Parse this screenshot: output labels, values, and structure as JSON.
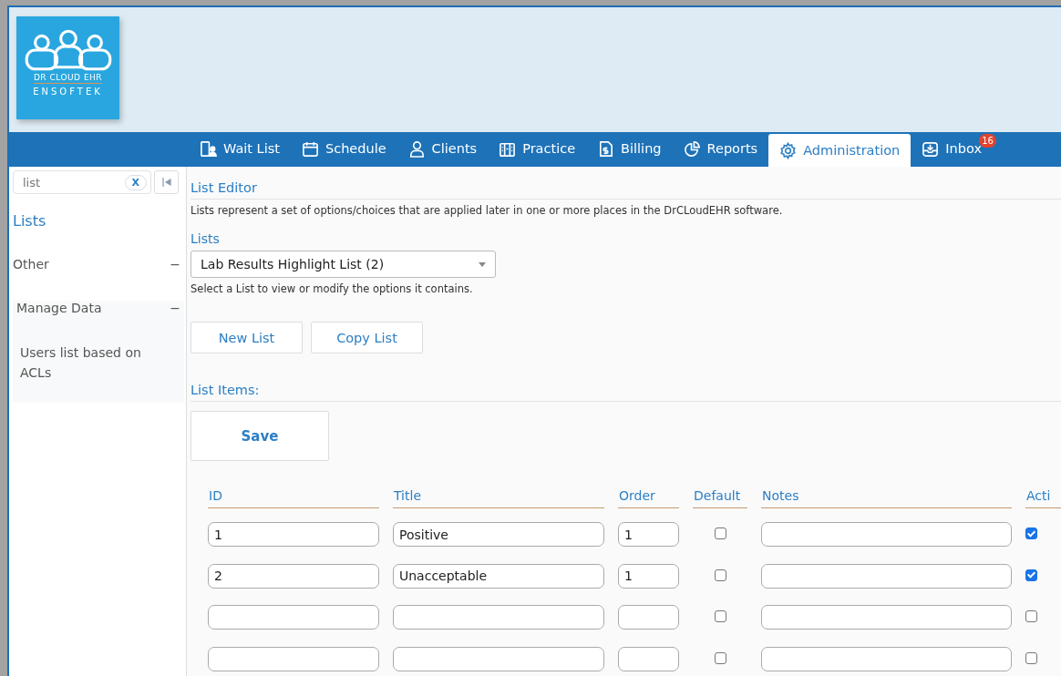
{
  "logo": {
    "name": "DR CLOUD EHR",
    "company": "ENSOFTEK"
  },
  "tabs": [
    {
      "label": "Wait List",
      "selected": false
    },
    {
      "label": "Schedule",
      "selected": false
    },
    {
      "label": "Clients",
      "selected": false
    },
    {
      "label": "Practice",
      "selected": false
    },
    {
      "label": "Billing",
      "selected": false
    },
    {
      "label": "Reports",
      "selected": false
    },
    {
      "label": "Administration",
      "selected": true
    },
    {
      "label": "Inbox",
      "selected": false,
      "badge": "16"
    }
  ],
  "sidebar": {
    "search": {
      "value": "list",
      "clear": "X"
    },
    "title": "Lists",
    "groups": [
      {
        "label": "Other",
        "toggle": "−"
      },
      {
        "label": "Manage Data",
        "toggle": "−",
        "children": [
          {
            "label": "Users list based on ACLs"
          }
        ]
      }
    ]
  },
  "editor": {
    "title": "List Editor",
    "description": "Lists represent a set of options/choices that are applied later in one or more places in the DrCLoudEHR software.",
    "lists_label": "Lists",
    "selected_list": "Lab Results Highlight List (2)",
    "select_hint": "Select a List to view or modify the options it contains.",
    "buttons": [
      "New List",
      "Copy List"
    ],
    "items_title": "List Items:",
    "save": "Save"
  },
  "table": {
    "columns": [
      "ID",
      "Title",
      "Order",
      "Default",
      "Notes",
      "Acti"
    ],
    "rows": [
      {
        "id": "1",
        "title": "Positive",
        "order": "1",
        "default": false,
        "notes": "",
        "active": true
      },
      {
        "id": "2",
        "title": "Unacceptable",
        "order": "1",
        "default": false,
        "notes": "",
        "active": true
      },
      {
        "id": "",
        "title": "",
        "order": "",
        "default": false,
        "notes": "",
        "active": false
      },
      {
        "id": "",
        "title": "",
        "order": "",
        "default": false,
        "notes": "",
        "active": false
      }
    ]
  }
}
